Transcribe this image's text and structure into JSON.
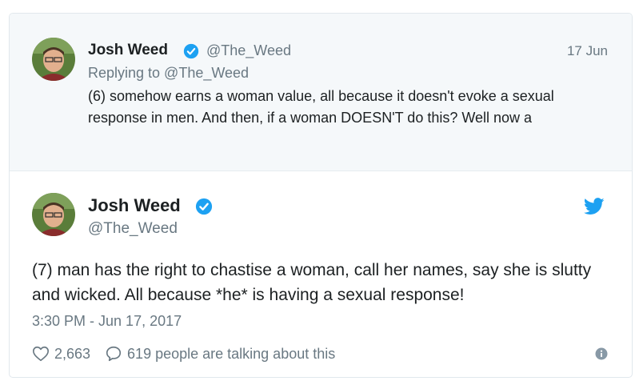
{
  "reply_tweet": {
    "author_name": "Josh Weed",
    "handle": "@The_Weed",
    "date": "17 Jun",
    "replying_to": "Replying to @The_Weed",
    "text": "(6) somehow earns a woman value, all because it doesn't evoke a sexual response in men. And then, if a woman DOESN'T do this? Well now a"
  },
  "main_tweet": {
    "author_name": "Josh Weed",
    "handle": "@The_Weed",
    "text": "(7) man has the right to chastise a woman, call her names, say she is slutty and wicked. All because *he* is having a sexual response!",
    "timestamp": "3:30 PM - Jun 17, 2017",
    "likes": "2,663",
    "talking": "619 people are talking about this"
  },
  "colors": {
    "verified": "#1da1f2",
    "muted_text": "#697882",
    "reply_bg": "#f5f8fa"
  },
  "icons": [
    "verified-badge-icon",
    "twitter-bird-icon",
    "heart-icon",
    "reply-bubble-icon",
    "info-icon"
  ]
}
